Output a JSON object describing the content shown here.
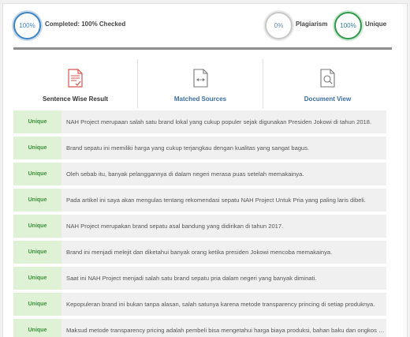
{
  "summary": {
    "completed_percent": "100%",
    "completed_label": "Completed: 100% Checked",
    "plagiarism_percent": "0%",
    "plagiarism_label": "Plagiarism",
    "unique_percent": "100%",
    "unique_label": "Unique"
  },
  "tabs": [
    {
      "label": "Sentence Wise Result",
      "icon": "checklist-document-icon",
      "color": "#333333"
    },
    {
      "label": "Matched Sources",
      "icon": "compare-document-icon",
      "color": "#3a6ea5"
    },
    {
      "label": "Document View",
      "icon": "search-document-icon",
      "color": "#3a6ea5"
    }
  ],
  "rows": [
    {
      "status": "Unique",
      "text": "NAH Project merupaan salah satu brand lokal yang cukup populer sejak digunakan Presiden Jokowi di tahun 2018."
    },
    {
      "status": "Unique",
      "text": "Brand sepatu ini memiliki harga yang cukup terjangkau dengan kualitas yang sangat bagus."
    },
    {
      "status": "Unique",
      "text": "Oleh sebab itu, banyak pelanggannya di dalam negeri merasa puas setelah memakainya."
    },
    {
      "status": "Unique",
      "text": "Pada artikel ini saya akan mengulas tentang rekomendasi sepatu NAH Project Untuk Pria yang paling laris dibeli."
    },
    {
      "status": "Unique",
      "text": "NAH Project merupakan brand sepatu asal bandung yang didirikan di tahun 2017."
    },
    {
      "status": "Unique",
      "text": "Brand ini menjadi melejit dan diketahui banyak orang ketika presiden Jokowi mencoba memakainya."
    },
    {
      "status": "Unique",
      "text": "Saat ini NAH Project menjadi salah satu brand sepatu pria dalam negeri yang banyak diminati."
    },
    {
      "status": "Unique",
      "text": "Kepopuleran brand ini bukan tanpa alasan, salah satunya karena metode transparency princing di setiap produknya."
    },
    {
      "status": "Unique",
      "text": "Maksud metode transparency pricing adalah pembeli bisa mengetahui harga biaya produksi, bahan baku dan ongkos kerja."
    }
  ]
}
